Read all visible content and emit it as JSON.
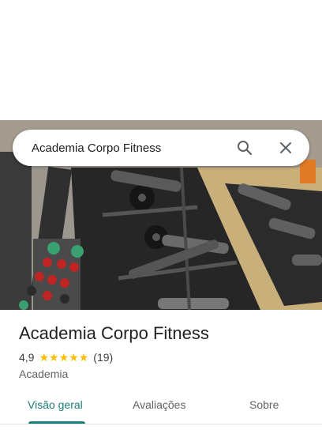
{
  "search": {
    "query": "Academia Corpo Fitness"
  },
  "icons": {
    "search": "search-icon",
    "close": "close-icon",
    "star": "star-icon"
  },
  "place": {
    "name": "Academia Corpo Fitness",
    "rating": "4,9",
    "stars": 5,
    "review_count": "(19)",
    "category": "Academia"
  },
  "tabs": [
    {
      "label": "Visão geral",
      "active": true
    },
    {
      "label": "Avaliações",
      "active": false
    },
    {
      "label": "Sobre",
      "active": false
    }
  ],
  "colors": {
    "accent": "#1a7f7a",
    "star": "#fbbc04"
  }
}
